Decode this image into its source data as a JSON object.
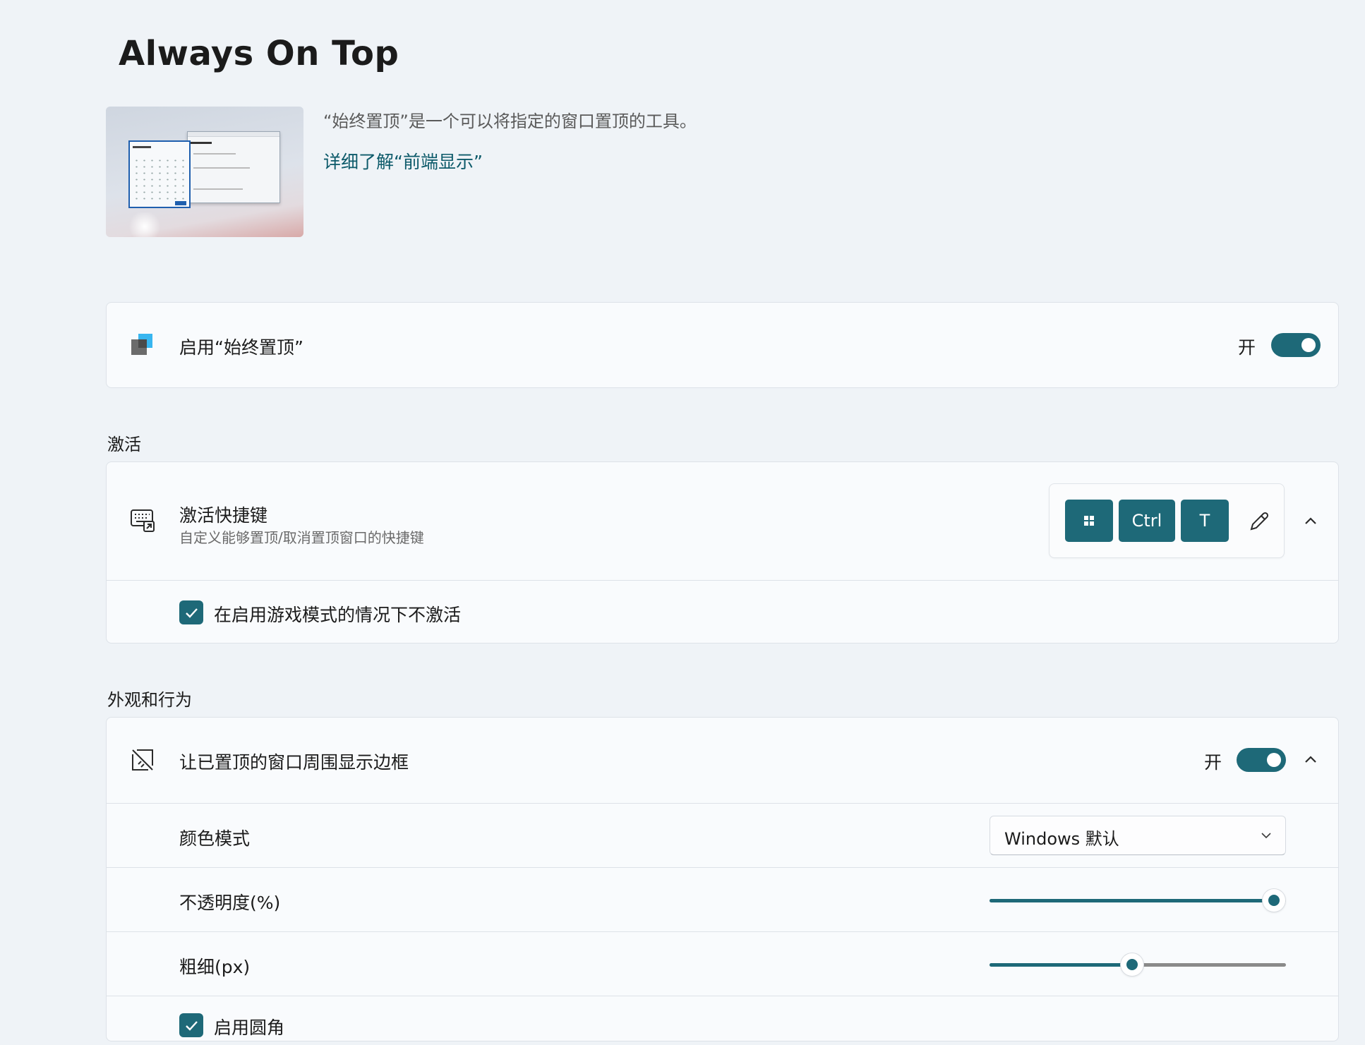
{
  "header": {
    "title": "Always On Top",
    "description": "“始终置顶”是一个可以将指定的窗口置顶的工具。",
    "learn_more": "详细了解“前端显示”"
  },
  "enable_card": {
    "label": "启用“始终置顶”",
    "state_label": "开",
    "enabled": true,
    "icon": "always-on-top-app-icon"
  },
  "activation": {
    "section_title": "激活",
    "shortcut": {
      "label": "激活快捷键",
      "description": "自定义能够置顶/取消置顶窗口的快捷键",
      "icon": "keyboard-shortcut-icon",
      "keys": [
        "win",
        "Ctrl",
        "T"
      ],
      "expanded": true
    },
    "game_mode": {
      "label": "在启用游戏模式的情况下不激活",
      "checked": true
    }
  },
  "appearance": {
    "section_title": "外观和行为",
    "border": {
      "label": "让已置顶的窗口周围显示边框",
      "state_label": "开",
      "enabled": true,
      "icon": "border-icon",
      "expanded": true
    },
    "color_mode": {
      "label": "颜色模式",
      "selected": "Windows 默认"
    },
    "opacity": {
      "label": "不透明度(%)",
      "value_fraction": 0.96
    },
    "thickness": {
      "label": "粗细(px)",
      "value_fraction": 0.48
    },
    "rounded_corners": {
      "label": "启用圆角",
      "checked": true
    }
  },
  "colors": {
    "accent": "#1e6978",
    "link": "#0c5a6a",
    "background": "#eff3f7",
    "card": "#f9fbfd"
  }
}
